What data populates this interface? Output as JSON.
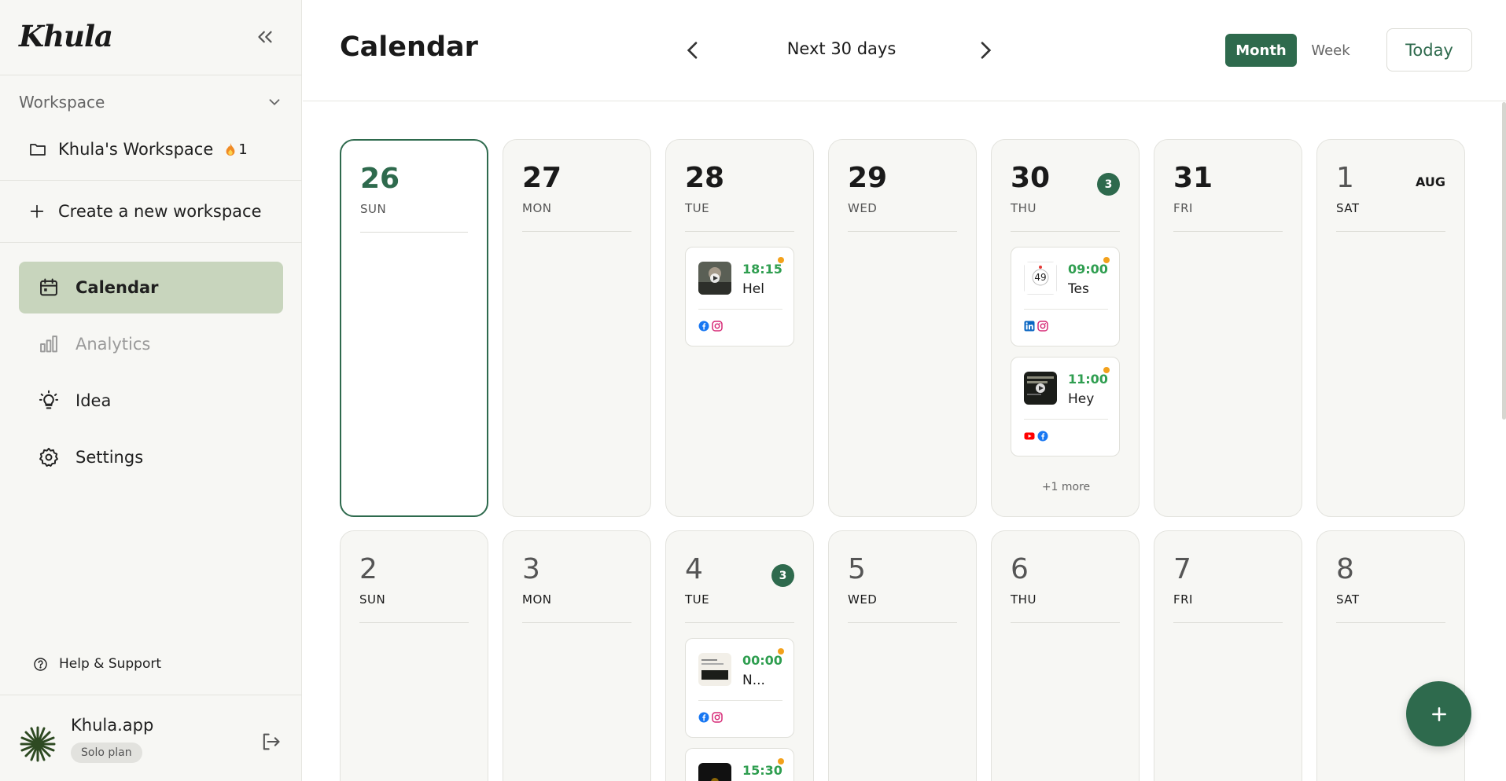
{
  "brand": {
    "logo_text": "Khula"
  },
  "sidebar": {
    "workspace_header": "Workspace",
    "workspace_name": "Khula's Workspace",
    "workspace_streak": "1",
    "create_workspace": "Create a new workspace",
    "nav": [
      {
        "label": "Calendar",
        "icon": "calendar-icon",
        "active": true
      },
      {
        "label": "Analytics",
        "icon": "bar-chart-icon",
        "active": false
      },
      {
        "label": "Idea",
        "icon": "lightbulb-icon",
        "active": false
      },
      {
        "label": "Settings",
        "icon": "gear-icon",
        "active": false
      }
    ],
    "help": "Help & Support",
    "account": {
      "name": "Khula.app",
      "plan": "Solo plan"
    }
  },
  "header": {
    "title": "Calendar",
    "range_label": "Next 30 days",
    "view_month": "Month",
    "view_week": "Week",
    "today": "Today"
  },
  "week1": [
    {
      "num": "26",
      "dow": "SUN"
    },
    {
      "num": "27",
      "dow": "MON"
    },
    {
      "num": "28",
      "dow": "TUE"
    },
    {
      "num": "29",
      "dow": "WED"
    },
    {
      "num": "30",
      "dow": "THU",
      "count": "3"
    },
    {
      "num": "31",
      "dow": "FRI"
    },
    {
      "num": "1",
      "dow": "SAT",
      "month": "AUG"
    }
  ],
  "week2": [
    {
      "num": "2",
      "dow": "SUN"
    },
    {
      "num": "3",
      "dow": "MON"
    },
    {
      "num": "4",
      "dow": "TUE",
      "count": "3"
    },
    {
      "num": "5",
      "dow": "WED"
    },
    {
      "num": "6",
      "dow": "THU"
    },
    {
      "num": "7",
      "dow": "FRI"
    },
    {
      "num": "8",
      "dow": "SAT"
    }
  ],
  "posts": {
    "d28_1": {
      "time": "18:15",
      "text": "Hel",
      "platforms": [
        "facebook",
        "instagram"
      ]
    },
    "d30_1": {
      "time": "09:00",
      "text": "Tes",
      "platforms": [
        "linkedin",
        "instagram"
      ]
    },
    "d30_2": {
      "time": "11:00",
      "text": "Hey",
      "platforms": [
        "youtube",
        "facebook"
      ]
    },
    "d30_more": "+1 more",
    "d4_1": {
      "time": "00:00",
      "text": "N...",
      "platforms": [
        "facebook",
        "instagram"
      ]
    },
    "d4_2": {
      "time": "15:30"
    }
  },
  "colors": {
    "accent": "#2e6a4d",
    "active_nav": "#c8d5bd",
    "time_green": "#2f9e50",
    "status_dot": "#f3a11b"
  }
}
